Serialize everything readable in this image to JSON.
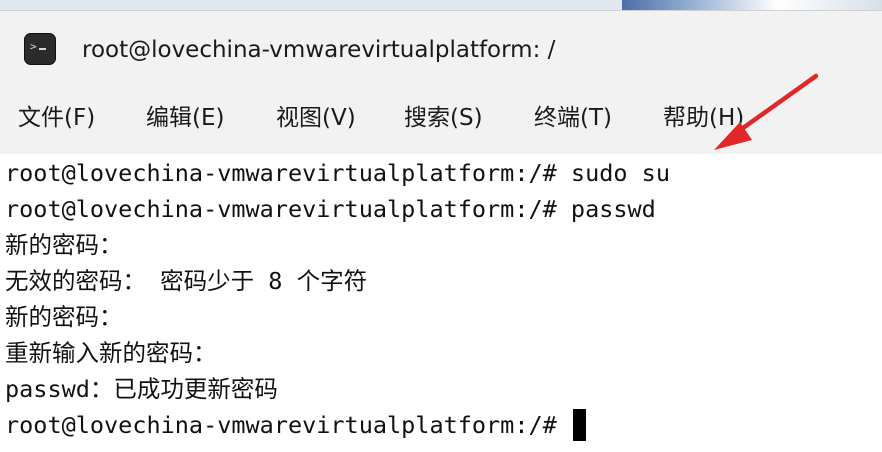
{
  "window": {
    "title": "root@lovechina-vmwarevirtualplatform: /",
    "icon": "terminal-icon"
  },
  "menu": {
    "items": [
      "文件(F)",
      "编辑(E)",
      "视图(V)",
      "搜索(S)",
      "终端(T)",
      "帮助(H)"
    ]
  },
  "terminal": {
    "lines": [
      "root@lovechina-vmwarevirtualplatform:/# sudo su",
      "root@lovechina-vmwarevirtualplatform:/# passwd",
      "新的密码：",
      "无效的密码： 密码少于 8 个字符",
      "新的密码：",
      "重新输入新的密码：",
      "passwd：已成功更新密码",
      "root@lovechina-vmwarevirtualplatform:/# "
    ]
  },
  "annotation": {
    "arrow_color": "#e0282a"
  }
}
